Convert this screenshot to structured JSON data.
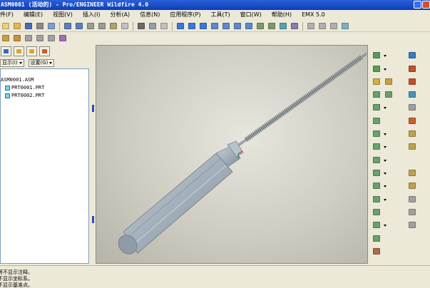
{
  "window": {
    "title": "ASM0001 (活动的) - Pro/ENGINEER Wildfire 4.0"
  },
  "menubar": {
    "items": [
      {
        "id": "file",
        "label": "件(F)"
      },
      {
        "id": "edit",
        "label": "编辑(E)"
      },
      {
        "id": "view",
        "label": "视图(V)"
      },
      {
        "id": "insert",
        "label": "插入(I)"
      },
      {
        "id": "analysis",
        "label": "分析(A)"
      },
      {
        "id": "info",
        "label": "信息(N)"
      },
      {
        "id": "applications",
        "label": "应用程序(P)"
      },
      {
        "id": "tools",
        "label": "工具(T)"
      },
      {
        "id": "window",
        "label": "窗口(W)"
      },
      {
        "id": "help",
        "label": "帮助(H)"
      },
      {
        "id": "emx",
        "label": "EMX 5.0"
      }
    ]
  },
  "left_panel": {
    "show_dropdown": "显示(I)",
    "settings_dropdown": "设置(G)",
    "tree": {
      "root": "ASM0001.ASM",
      "children": [
        "PRT0001.PRT",
        "PRT0002.PRT"
      ]
    }
  },
  "messages": [
    "将不显示注释。",
    "不显示坐标系。",
    "不显示基准点。"
  ],
  "colors": {
    "titlebar": "#0b3fb8",
    "viewport_bg": "#cfcdc2",
    "handle": "#a7b3bf",
    "screw": "#b2b8bd"
  }
}
